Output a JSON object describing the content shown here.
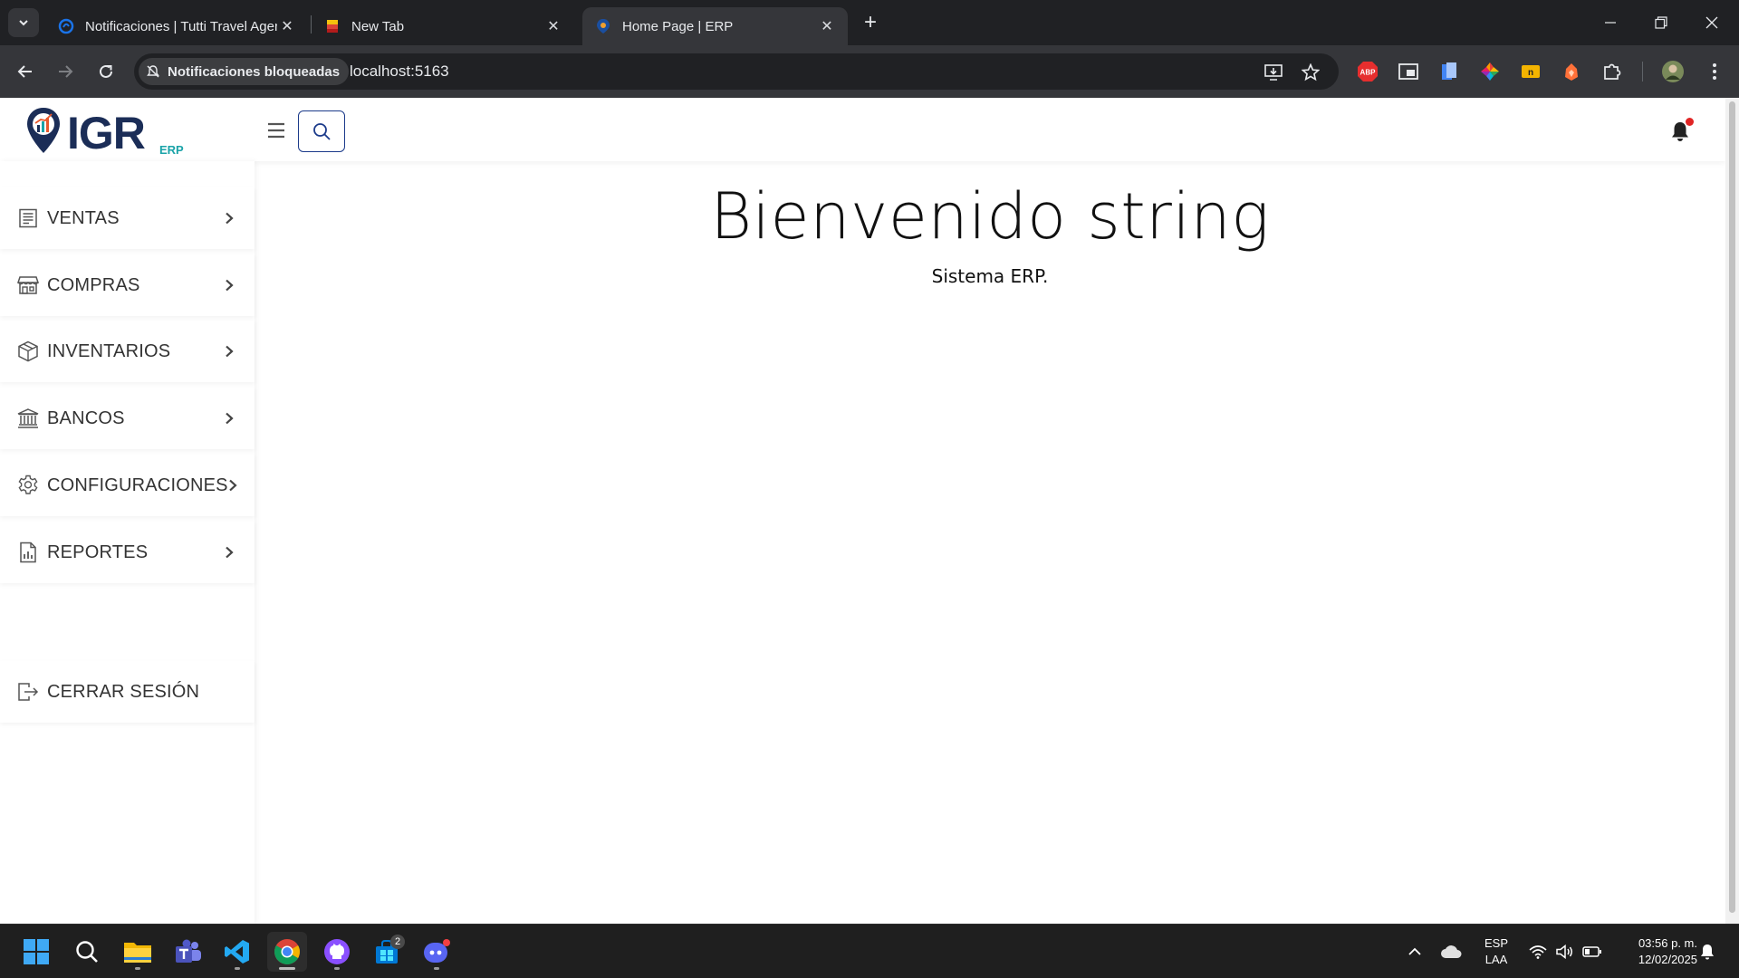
{
  "browser": {
    "tabs": [
      {
        "title": "Notificaciones | Tutti Travel Agency",
        "active": false
      },
      {
        "title": "New Tab",
        "active": false
      },
      {
        "title": "Home Page | ERP",
        "active": true
      }
    ],
    "site_chip": "Notificaciones bloqueadas",
    "url": "localhost:5163"
  },
  "app": {
    "logo_text": "IGR",
    "logo_sub": "ERP",
    "colors": {
      "brand_navy": "#1b2d57",
      "brand_teal": "#1aa3a8",
      "notification_dot": "#e02424"
    }
  },
  "sidebar": {
    "items": [
      {
        "label": "VENTAS",
        "icon": "receipt-list-icon"
      },
      {
        "label": "COMPRAS",
        "icon": "store-icon"
      },
      {
        "label": "INVENTARIOS",
        "icon": "box-icon"
      },
      {
        "label": "BANCOS",
        "icon": "bank-icon"
      },
      {
        "label": "CONFIGURACIONES",
        "icon": "gear-icon"
      },
      {
        "label": "REPORTES",
        "icon": "report-chart-icon"
      }
    ],
    "logout_label": "CERRAR SESIÓN"
  },
  "main": {
    "welcome": "Bienvenido string",
    "subtitle": "Sistema ERP."
  },
  "taskbar": {
    "language": "ESP",
    "layout": "LAA",
    "time": "03:56 p. m.",
    "date": "12/02/2025",
    "store_badge": "2"
  }
}
